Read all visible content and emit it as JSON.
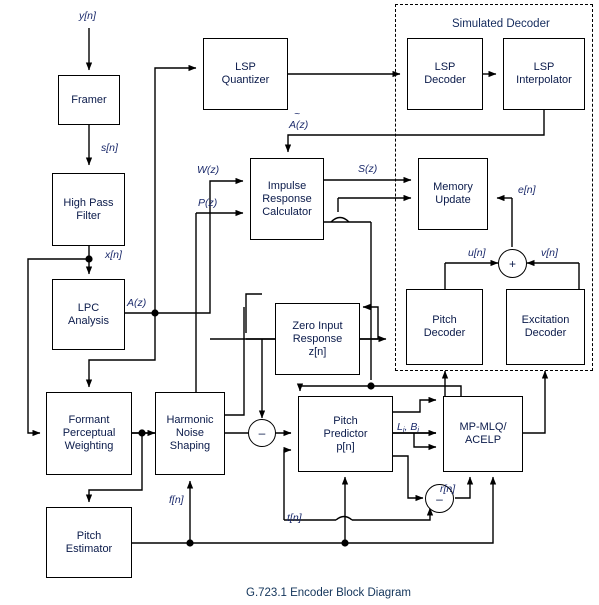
{
  "diagram": {
    "caption": "G.723.1 Encoder Block Diagram",
    "dashed_region_label": "Simulated Decoder",
    "ink_color": "#000000",
    "block_text_color": "#0a1a4a",
    "signal_label_color": "#1b2a6b"
  },
  "blocks": {
    "framer": "Framer",
    "high_pass_filter": "High Pass\nFilter",
    "lpc_analysis": "LPC\nAnalysis",
    "formant_perceptual_weighting": "Formant\nPerceptual\nWeighting",
    "harmonic_noise_shaping": "Harmonic\nNoise\nShaping",
    "pitch_estimator": "Pitch\nEstimator",
    "lsp_quantizer": "LSP\nQuantizer",
    "lsp_decoder": "LSP\nDecoder",
    "lsp_interpolator": "LSP\nInterpolator",
    "impulse_response_calculator": "Impulse\nResponse\nCalculator",
    "memory_update": "Memory\nUpdate",
    "zero_input_response": "Zero Input\nResponse\nz[n]",
    "pitch_decoder": "Pitch\nDecoder",
    "excitation_decoder": "Excitation\nDecoder",
    "pitch_predictor": "Pitch\nPredictor\np[n]",
    "mp_mlq_acelp": "MP-MLQ/\nACELP"
  },
  "signals": {
    "y_n": "y[n]",
    "s_n": "s[n]",
    "x_n": "x[n]",
    "a_z": "A(z)",
    "a_tilde_z": "A(z)",
    "a_tilde_mark": "~",
    "w_z": "W(z)",
    "p_z": "P(z)",
    "s_cap_z": "S(z)",
    "e_n": "e[n]",
    "u_n": "u[n]",
    "v_n": "v[n]",
    "f_n": "f[n]",
    "t_n": "t[n]",
    "r_n": "r[n]",
    "lb": "L",
    "lb_sub1": "i",
    "lb_mid": ", B",
    "lb_sub2": "i"
  },
  "operators": {
    "sum_plus": "+",
    "diff_main": "–",
    "diff_residual": "–"
  }
}
